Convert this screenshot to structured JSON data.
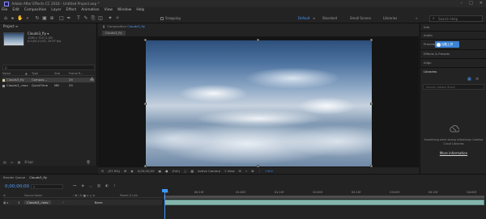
{
  "window": {
    "title": "Adobe After Effects CC 2018 - Untitled Project.aep *",
    "controls": [
      "–",
      "□",
      "✕"
    ]
  },
  "menu": [
    "File",
    "Edit",
    "Composition",
    "Layer",
    "Effect",
    "Animation",
    "View",
    "Window",
    "Help"
  ],
  "toolbar": {
    "snapping_label": "Snapping",
    "workspaces": [
      "Default",
      "≡",
      "Standard",
      "Small Screen",
      "Libraries"
    ],
    "active_workspace": "Default",
    "more": "»",
    "search_placeholder": "Search Help"
  },
  "project": {
    "tab_label": "Project ≡",
    "selected_item": {
      "name": "Clouds3_fly ▾",
      "info_line1": "1280 x 720 (1.00)",
      "info_line2": "Δ 0;00;11;05, 29.97 fps"
    },
    "search_placeholder": "ρ.",
    "columns": [
      "Name",
      "▲",
      "Type",
      "Size",
      "Frame R..."
    ],
    "rows": [
      {
        "name": "Clouds3_fly",
        "type": "Compos...",
        "size": "",
        "rate": "29",
        "swatch": "#d9d0a0",
        "selected": true
      },
      {
        "name": "Clouds3_.mov",
        "type": "QuickTime",
        "size": "MB",
        "rate": "29",
        "swatch": "#9b9b9b",
        "selected": false
      }
    ],
    "bottom_label": "8 bpc"
  },
  "composition": {
    "tab_prefix": "Composition",
    "tab_name": "Clouds3_fly",
    "subtab": "Clouds3_fly",
    "controls": {
      "zoom": "(97.9%)",
      "time": "0;00;00;00",
      "resolution": "(Full)",
      "camera": "Active Camera",
      "view": "1 View",
      "offset": "+0.0"
    }
  },
  "right_panel": {
    "tabs": [
      "Info",
      "Audio",
      "Preview",
      "Effects & Presets",
      "Align"
    ],
    "libraries_label": "Libraries",
    "tooltip": "加载上拼",
    "search_placeholder": "Search Adobe Stock",
    "message": "Something went wrong initializing Creative Cloud Libraries",
    "link": "More information"
  },
  "timeline": {
    "tabs": [
      "Render Queue",
      "Clouds3_fly"
    ],
    "active_tab": "Clouds3_fly",
    "timecode": "0;00;00;00",
    "search_placeholder": "ρ.",
    "columns": [
      "#",
      "Source Name",
      "♯ ✱ \\ fx ■ ⊘ ◎ ⊕",
      "Parent & Link"
    ],
    "layer": {
      "number": "1",
      "name": "Clouds3_.mov",
      "parent": "None"
    },
    "ruler_ticks": [
      "0f",
      "00:15f",
      "01:00f",
      "01:15f",
      "02:00f",
      "02:15f",
      "03:00f",
      "03:15f",
      "04:00f",
      "04:15f",
      "05:00f"
    ]
  }
}
